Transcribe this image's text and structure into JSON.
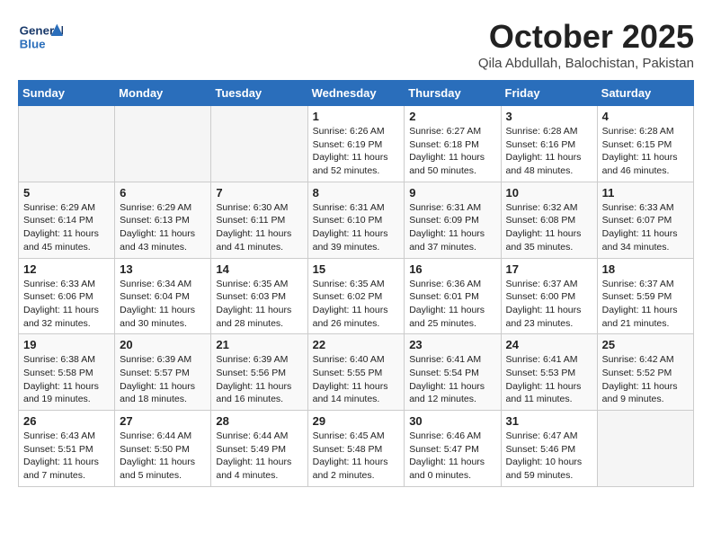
{
  "header": {
    "logo_general": "General",
    "logo_blue": "Blue",
    "month_title": "October 2025",
    "location": "Qila Abdullah, Balochistan, Pakistan"
  },
  "days_of_week": [
    "Sunday",
    "Monday",
    "Tuesday",
    "Wednesday",
    "Thursday",
    "Friday",
    "Saturday"
  ],
  "weeks": [
    [
      {
        "day": "",
        "info": ""
      },
      {
        "day": "",
        "info": ""
      },
      {
        "day": "",
        "info": ""
      },
      {
        "day": "1",
        "info": "Sunrise: 6:26 AM\nSunset: 6:19 PM\nDaylight: 11 hours and 52 minutes."
      },
      {
        "day": "2",
        "info": "Sunrise: 6:27 AM\nSunset: 6:18 PM\nDaylight: 11 hours and 50 minutes."
      },
      {
        "day": "3",
        "info": "Sunrise: 6:28 AM\nSunset: 6:16 PM\nDaylight: 11 hours and 48 minutes."
      },
      {
        "day": "4",
        "info": "Sunrise: 6:28 AM\nSunset: 6:15 PM\nDaylight: 11 hours and 46 minutes."
      }
    ],
    [
      {
        "day": "5",
        "info": "Sunrise: 6:29 AM\nSunset: 6:14 PM\nDaylight: 11 hours and 45 minutes."
      },
      {
        "day": "6",
        "info": "Sunrise: 6:29 AM\nSunset: 6:13 PM\nDaylight: 11 hours and 43 minutes."
      },
      {
        "day": "7",
        "info": "Sunrise: 6:30 AM\nSunset: 6:11 PM\nDaylight: 11 hours and 41 minutes."
      },
      {
        "day": "8",
        "info": "Sunrise: 6:31 AM\nSunset: 6:10 PM\nDaylight: 11 hours and 39 minutes."
      },
      {
        "day": "9",
        "info": "Sunrise: 6:31 AM\nSunset: 6:09 PM\nDaylight: 11 hours and 37 minutes."
      },
      {
        "day": "10",
        "info": "Sunrise: 6:32 AM\nSunset: 6:08 PM\nDaylight: 11 hours and 35 minutes."
      },
      {
        "day": "11",
        "info": "Sunrise: 6:33 AM\nSunset: 6:07 PM\nDaylight: 11 hours and 34 minutes."
      }
    ],
    [
      {
        "day": "12",
        "info": "Sunrise: 6:33 AM\nSunset: 6:06 PM\nDaylight: 11 hours and 32 minutes."
      },
      {
        "day": "13",
        "info": "Sunrise: 6:34 AM\nSunset: 6:04 PM\nDaylight: 11 hours and 30 minutes."
      },
      {
        "day": "14",
        "info": "Sunrise: 6:35 AM\nSunset: 6:03 PM\nDaylight: 11 hours and 28 minutes."
      },
      {
        "day": "15",
        "info": "Sunrise: 6:35 AM\nSunset: 6:02 PM\nDaylight: 11 hours and 26 minutes."
      },
      {
        "day": "16",
        "info": "Sunrise: 6:36 AM\nSunset: 6:01 PM\nDaylight: 11 hours and 25 minutes."
      },
      {
        "day": "17",
        "info": "Sunrise: 6:37 AM\nSunset: 6:00 PM\nDaylight: 11 hours and 23 minutes."
      },
      {
        "day": "18",
        "info": "Sunrise: 6:37 AM\nSunset: 5:59 PM\nDaylight: 11 hours and 21 minutes."
      }
    ],
    [
      {
        "day": "19",
        "info": "Sunrise: 6:38 AM\nSunset: 5:58 PM\nDaylight: 11 hours and 19 minutes."
      },
      {
        "day": "20",
        "info": "Sunrise: 6:39 AM\nSunset: 5:57 PM\nDaylight: 11 hours and 18 minutes."
      },
      {
        "day": "21",
        "info": "Sunrise: 6:39 AM\nSunset: 5:56 PM\nDaylight: 11 hours and 16 minutes."
      },
      {
        "day": "22",
        "info": "Sunrise: 6:40 AM\nSunset: 5:55 PM\nDaylight: 11 hours and 14 minutes."
      },
      {
        "day": "23",
        "info": "Sunrise: 6:41 AM\nSunset: 5:54 PM\nDaylight: 11 hours and 12 minutes."
      },
      {
        "day": "24",
        "info": "Sunrise: 6:41 AM\nSunset: 5:53 PM\nDaylight: 11 hours and 11 minutes."
      },
      {
        "day": "25",
        "info": "Sunrise: 6:42 AM\nSunset: 5:52 PM\nDaylight: 11 hours and 9 minutes."
      }
    ],
    [
      {
        "day": "26",
        "info": "Sunrise: 6:43 AM\nSunset: 5:51 PM\nDaylight: 11 hours and 7 minutes."
      },
      {
        "day": "27",
        "info": "Sunrise: 6:44 AM\nSunset: 5:50 PM\nDaylight: 11 hours and 5 minutes."
      },
      {
        "day": "28",
        "info": "Sunrise: 6:44 AM\nSunset: 5:49 PM\nDaylight: 11 hours and 4 minutes."
      },
      {
        "day": "29",
        "info": "Sunrise: 6:45 AM\nSunset: 5:48 PM\nDaylight: 11 hours and 2 minutes."
      },
      {
        "day": "30",
        "info": "Sunrise: 6:46 AM\nSunset: 5:47 PM\nDaylight: 11 hours and 0 minutes."
      },
      {
        "day": "31",
        "info": "Sunrise: 6:47 AM\nSunset: 5:46 PM\nDaylight: 10 hours and 59 minutes."
      },
      {
        "day": "",
        "info": ""
      }
    ]
  ]
}
